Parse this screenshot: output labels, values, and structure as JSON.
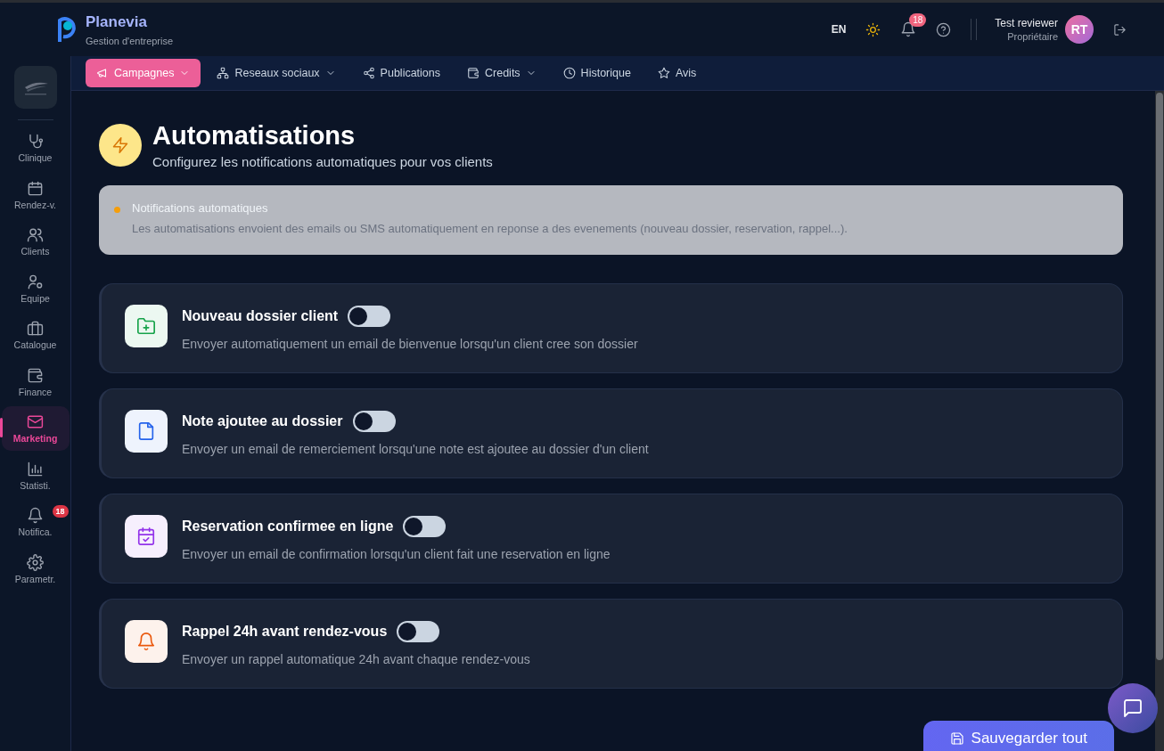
{
  "header": {
    "app_name": "Planevia",
    "subtitle": "Gestion d'entreprise",
    "language": "EN",
    "notifications_badge": "18",
    "user_name": "Test reviewer",
    "user_role": "Propriétaire",
    "avatar_initials": "RT"
  },
  "sidebar": {
    "items": [
      {
        "label": "Clinique",
        "selected": false
      },
      {
        "label": "Rendez-v.",
        "selected": false
      },
      {
        "label": "Clients",
        "selected": false
      },
      {
        "label": "Equipe",
        "selected": false
      },
      {
        "label": "Catalogue",
        "selected": false
      },
      {
        "label": "Finance",
        "selected": false
      },
      {
        "label": "Marketing",
        "selected": true
      },
      {
        "label": "Statisti.",
        "selected": false
      },
      {
        "label": "Notifica.",
        "selected": false,
        "badge": "18"
      },
      {
        "label": "Parametr.",
        "selected": false
      }
    ]
  },
  "tabs": [
    {
      "label": "Campagnes",
      "selected": true,
      "dropdown": true
    },
    {
      "label": "Reseaux sociaux",
      "selected": false,
      "dropdown": true
    },
    {
      "label": "Publications",
      "selected": false,
      "dropdown": false
    },
    {
      "label": "Credits",
      "selected": false,
      "dropdown": true
    },
    {
      "label": "Historique",
      "selected": false,
      "dropdown": false
    },
    {
      "label": "Avis",
      "selected": false,
      "dropdown": false
    }
  ],
  "page": {
    "title": "Automatisations",
    "subtitle": "Configurez les notifications automatiques pour vos clients"
  },
  "notice": {
    "title": "Notifications automatiques",
    "text": "Les automatisations envoient des emails ou SMS automatiquement en reponse a des evenements (nouveau dossier, reservation, rappel...)."
  },
  "automations": [
    {
      "title": "Nouveau dossier client",
      "description": "Envoyer automatiquement un email de bienvenue lorsqu'un client cree son dossier",
      "on": false,
      "color": "#16a34a"
    },
    {
      "title": "Note ajoutee au dossier",
      "description": "Envoyer un email de remerciement lorsqu'une note est ajoutee au dossier d'un client",
      "on": false,
      "color": "#2563eb"
    },
    {
      "title": "Reservation confirmee en ligne",
      "description": "Envoyer un email de confirmation lorsqu'un client fait une reservation en ligne",
      "on": false,
      "color": "#9333ea"
    },
    {
      "title": "Rappel 24h avant rendez-vous",
      "description": "Envoyer un rappel automatique 24h avant chaque rendez-vous",
      "on": false,
      "color": "#ea580c"
    }
  ],
  "save_button": "Sauvegarder tout"
}
